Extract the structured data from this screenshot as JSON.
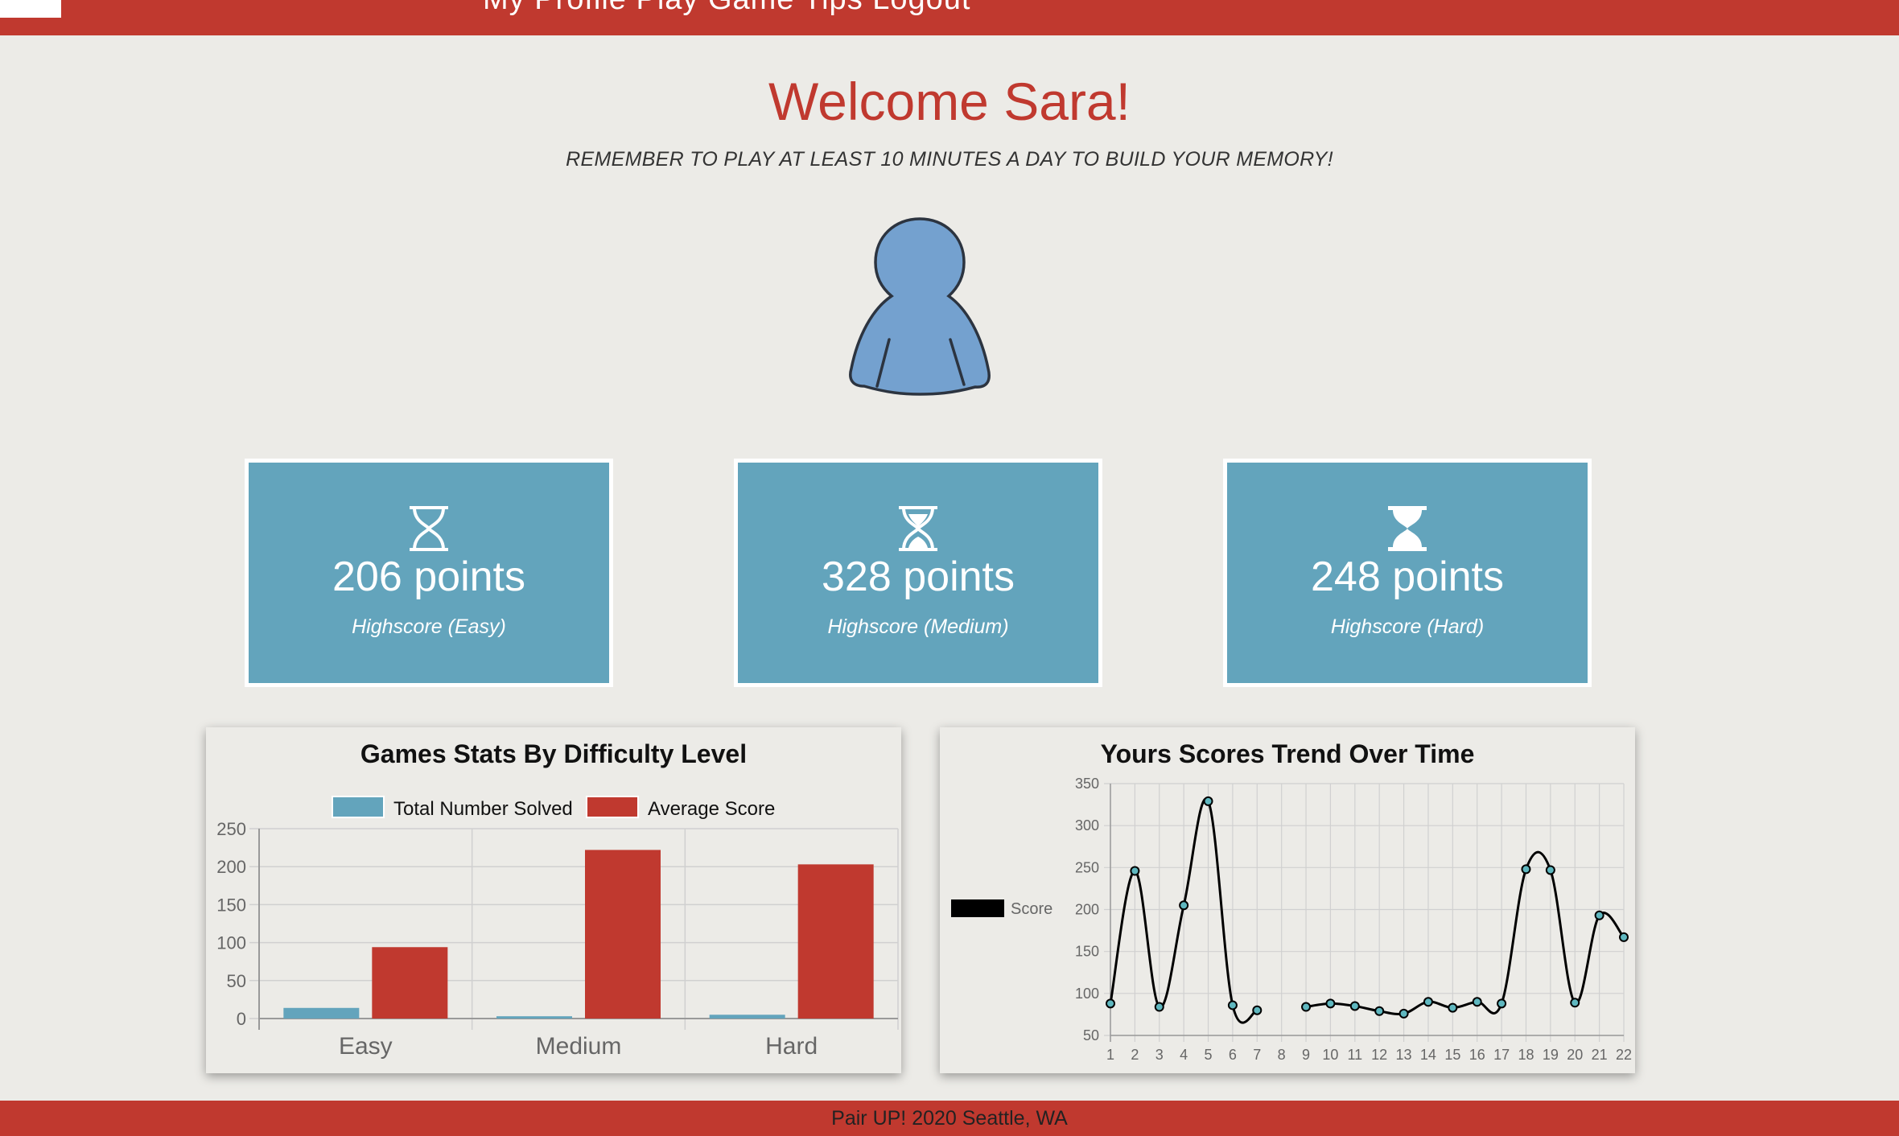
{
  "header": {
    "nav_text": "My Profile   Play Game   Tips   Logout"
  },
  "welcome": {
    "title": "Welcome Sara!",
    "subtitle": "REMEMBER TO PLAY AT LEAST 10 MINUTES A DAY TO BUILD YOUR MEMORY!"
  },
  "highscores": [
    {
      "value": "206 points",
      "label": "Highscore (Easy)",
      "icon": "hourglass-start-icon"
    },
    {
      "value": "328 points",
      "label": "Highscore (Medium)",
      "icon": "hourglass-half-icon"
    },
    {
      "value": "248 points",
      "label": "Highscore (Hard)",
      "icon": "hourglass-end-icon"
    }
  ],
  "colors": {
    "brand_red": "#c0392f",
    "card_blue": "#63a4bc",
    "avatar_blue": "#74a1cf",
    "background": "#ecebe7"
  },
  "chart_data": [
    {
      "type": "bar",
      "title": "Games Stats By Difficulty Level",
      "categories": [
        "Easy",
        "Medium",
        "Hard"
      ],
      "series": [
        {
          "name": "Total Number Solved",
          "values": [
            14,
            3,
            5
          ],
          "color": "#63a4bc"
        },
        {
          "name": "Average Score",
          "values": [
            94,
            222,
            203
          ],
          "color": "#c0392f"
        }
      ],
      "ylim": [
        0,
        250
      ],
      "yticks": [
        "0",
        "50",
        "100",
        "150",
        "200",
        "250"
      ],
      "legend": "top",
      "grid": true
    },
    {
      "type": "line",
      "title": "Yours Scores Trend Over Time",
      "x": [
        "1",
        "2",
        "3",
        "4",
        "5",
        "6",
        "7",
        "8",
        "9",
        "10",
        "11",
        "12",
        "13",
        "14",
        "15",
        "16",
        "17",
        "18",
        "19",
        "20",
        "21",
        "22"
      ],
      "series": [
        {
          "name": "Score",
          "values": [
            88,
            246,
            84,
            205,
            329,
            86,
            80,
            null,
            84,
            88,
            85,
            79,
            76,
            90,
            83,
            90,
            88,
            248,
            247,
            89,
            193,
            167
          ],
          "color": "#000000"
        }
      ],
      "ylim": [
        50,
        350
      ],
      "yticks": [
        "50",
        "100",
        "150",
        "200",
        "250",
        "300",
        "350"
      ],
      "legend": "left",
      "grid": true
    }
  ],
  "footer": {
    "text": "Pair UP! 2020 Seattle, WA"
  }
}
